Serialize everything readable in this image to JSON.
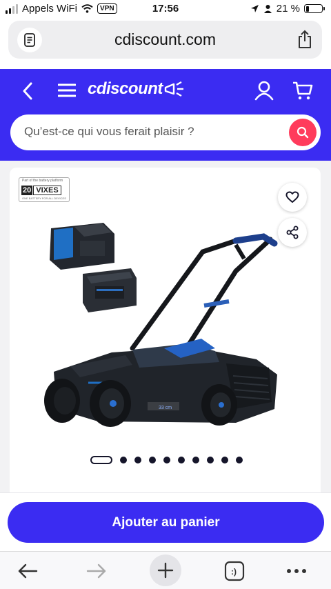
{
  "status_bar": {
    "carrier": "Appels WiFi",
    "vpn": "VPN",
    "time": "17:56",
    "battery": "21 %",
    "battery_level": 0.21
  },
  "browser": {
    "url": "cdiscount.com"
  },
  "header": {
    "logo": "cdiscount",
    "search_placeholder": "Qu’est-ce qui vous ferait plaisir ?",
    "brand_color": "#3b2cf2",
    "search_button_color": "#ff3b5c"
  },
  "product": {
    "badge_top": "Part of the battery platform",
    "badge_number": "20",
    "badge_brand": "VIXES",
    "badge_bottom": "ONE BATTERY FOR ALL DEVICES",
    "deck_label": "33 cm",
    "gallery_dots": 10,
    "active_dot": 0
  },
  "actions": {
    "add_to_cart": "Ajouter au panier"
  },
  "icons": {
    "back": "chevron-left-icon",
    "menu": "hamburger-icon",
    "user": "user-icon",
    "cart": "cart-icon",
    "search": "search-icon",
    "favorite": "heart-icon",
    "share": "share-icon",
    "browser_back": "arrow-left-icon",
    "browser_forward": "arrow-right-icon",
    "new_tab": "plus-icon",
    "tabs": "tabs-icon",
    "more": "more-icon"
  }
}
